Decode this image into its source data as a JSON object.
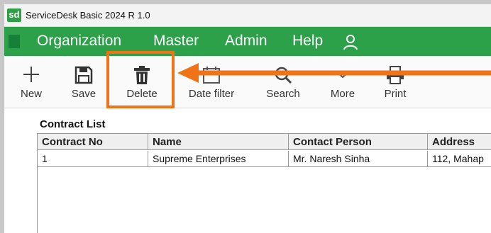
{
  "window": {
    "app_logo": "sd",
    "title": "ServiceDesk Basic 2024 R 1.0"
  },
  "menu": {
    "items": [
      "Organization",
      "Master",
      "Admin",
      "Help"
    ],
    "user_icon": "user-icon"
  },
  "toolbar": {
    "buttons": [
      {
        "label": "New",
        "icon": "plus-icon"
      },
      {
        "label": "Save",
        "icon": "floppy-disk-icon"
      },
      {
        "label": "Delete",
        "icon": "trash-icon"
      },
      {
        "label": "Date filter",
        "icon": "calendar-icon"
      },
      {
        "label": "Search",
        "icon": "magnifier-icon"
      },
      {
        "label": "More",
        "icon": "chevron-down-icon"
      },
      {
        "label": "Print",
        "icon": "printer-icon"
      }
    ]
  },
  "annotation": {
    "color": "#f07318",
    "highlighted_button": "Delete"
  },
  "contract_list": {
    "title": "Contract List",
    "columns": [
      "Contract No",
      "Name",
      "Contact Person",
      "Address"
    ],
    "rows": [
      [
        "1",
        "Supreme Enterprises",
        "Mr. Naresh Sinha",
        "112, Mahap"
      ]
    ]
  },
  "colors": {
    "menubar": "#2da04a",
    "accent": "#f07318"
  }
}
